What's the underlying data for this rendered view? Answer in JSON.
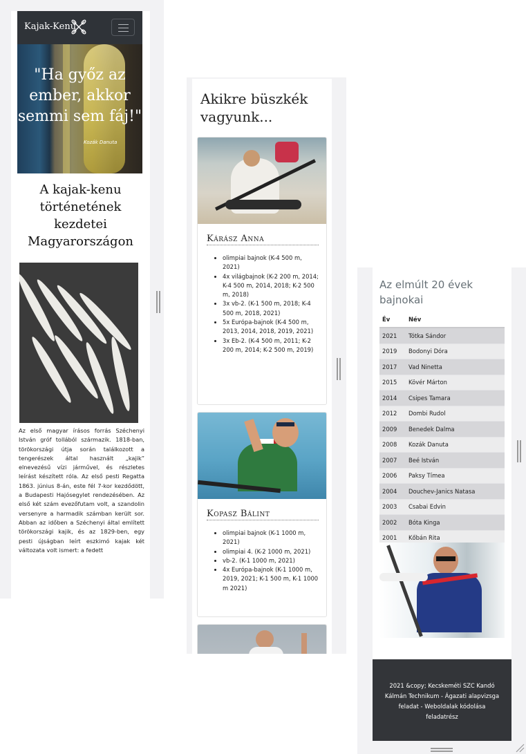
{
  "panel1": {
    "brand": "Kajak-Kenu",
    "brand_icon": "crossed-paddles-icon",
    "menu_icon": "hamburger-icon",
    "hero_quote": "\"Ha győz az ember, akkor semmi sem fáj!\"",
    "hero_author": "Kozák Danuta",
    "title": "A kajak-kenu történetének kezdetei Magyarországon",
    "body": "Az első magyar írásos forrás Széchenyi István gróf tollából származik. 1818-ban, törökországi útja során találkozott a tengerészek által használt „kajik” elnevezésű vízi járművel, és részletes leírást készített róla. Az első pesti Regatta 1863. június 8-án, este fél 7-kor kezdődött, a Budapesti Hajósegylet rendezésében. Az első két szám evezőfutam volt, a szandolin versenyre a harmadik számban került sor. Abban az időben a Széchenyi által említett törökországi kajik, és az 1829-ben, egy pesti újságban leírt eszkimó kajak két változata volt ismert: a fedett"
  },
  "panel2": {
    "title": "Akikre büszkék vagyunk...",
    "cards": [
      {
        "name": "Kárász Anna",
        "achievements": [
          "olimpiai bajnok (K-4 500 m, 2021)",
          "4x világbajnok (K-2 200 m, 2014; K-4 500 m, 2014, 2018; K-2 500 m, 2018)",
          "3x vb-2. (K-1 500 m, 2018; K-4 500 m, 2018, 2021)",
          "5x Európa-bajnok (K-4 500 m, 2013, 2014, 2018, 2019, 2021)",
          "3x Eb-2. (K-4 500 m, 2011; K-2 200 m, 2014; K-2 500 m, 2019)"
        ]
      },
      {
        "name": "Kopasz Bálint",
        "achievements": [
          "olimpiai bajnok (K-1 1000 m, 2021)",
          "olimpiai 4. (K-2 1000 m, 2021)",
          "vb-2. (K-1 1000 m, 2021)",
          "4x Európa-bajnok (K-1 1000 m, 2019, 2021; K-1 500 m, K-1 1000 m 2021)"
        ]
      }
    ]
  },
  "panel3": {
    "title": "Az elmúlt 20 évek bajnokai",
    "columns": [
      "Év",
      "Név"
    ],
    "rows": [
      [
        "2021",
        "Tótka Sándor"
      ],
      [
        "2019",
        "Bodonyi Dóra"
      ],
      [
        "2017",
        "Vad Ninetta"
      ],
      [
        "2015",
        "Kövér Márton"
      ],
      [
        "2014",
        "Csipes Tamara"
      ],
      [
        "2012",
        "Dombi Rudol"
      ],
      [
        "2009",
        "Benedek Dalma"
      ],
      [
        "2008",
        "Kozák Danuta"
      ],
      [
        "2007",
        "Beé István"
      ],
      [
        "2006",
        "Paksy Tímea"
      ],
      [
        "2004",
        "Douchev-Janics Natasa"
      ],
      [
        "2003",
        "Csabai Edvin"
      ],
      [
        "2002",
        "Bóta Kinga"
      ],
      [
        "2001",
        "Kőbán Rita"
      ]
    ],
    "footer": "2021 &copy; Kecskeméti SZC Kandó Kálmán Technikum - Ágazati alapvizsga feladat - Weboldalak kódolása feladatrész"
  }
}
